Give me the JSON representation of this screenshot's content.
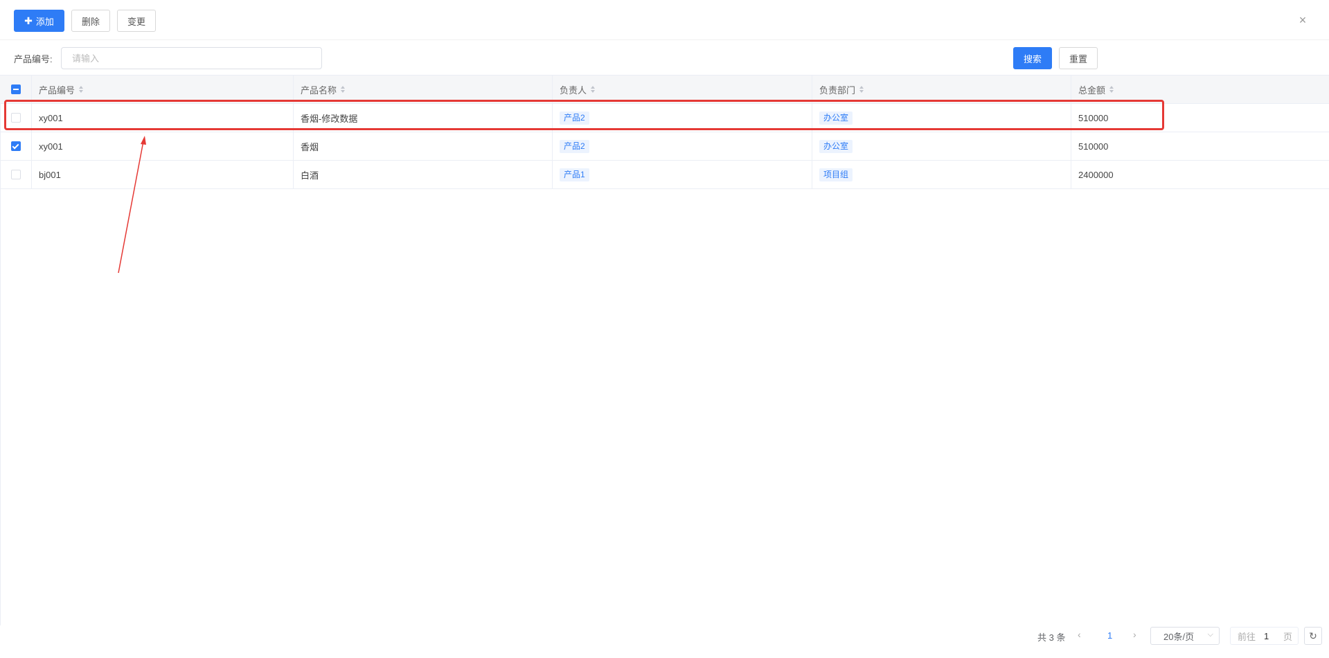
{
  "toolbar": {
    "add_label": "添加",
    "delete_label": "删除",
    "change_label": "变更",
    "close_glyph": "×"
  },
  "filter": {
    "label": "产品编号:",
    "placeholder": "请输入",
    "value": "",
    "search_label": "搜索",
    "reset_label": "重置"
  },
  "table": {
    "columns": [
      "产品编号",
      "产品名称",
      "负责人",
      "负责部门",
      "总金额"
    ],
    "header_checkbox_state": "indeterminate",
    "rows": [
      {
        "checked": false,
        "code": "xy001",
        "name": "香烟-修改数据",
        "owner": "产品2",
        "dept": "办公室",
        "amount": "510000"
      },
      {
        "checked": true,
        "code": "xy001",
        "name": "香烟",
        "owner": "产品2",
        "dept": "办公室",
        "amount": "510000"
      },
      {
        "checked": false,
        "code": "bj001",
        "name": "白酒",
        "owner": "产品1",
        "dept": "项目组",
        "amount": "2400000"
      }
    ]
  },
  "annotation": {
    "color": "#e53935",
    "highlight": "row 1",
    "arrow": "points to highlighted row"
  },
  "pagination": {
    "total_text": "共 3 条",
    "current_page": "1",
    "page_size": "20条/页",
    "jump_prefix": "前往",
    "jump_value": "1",
    "jump_suffix": "页"
  },
  "colors": {
    "primary": "#2e7cf6",
    "tag_bg": "#ecf3fe",
    "header_bg": "#f5f6f8"
  }
}
